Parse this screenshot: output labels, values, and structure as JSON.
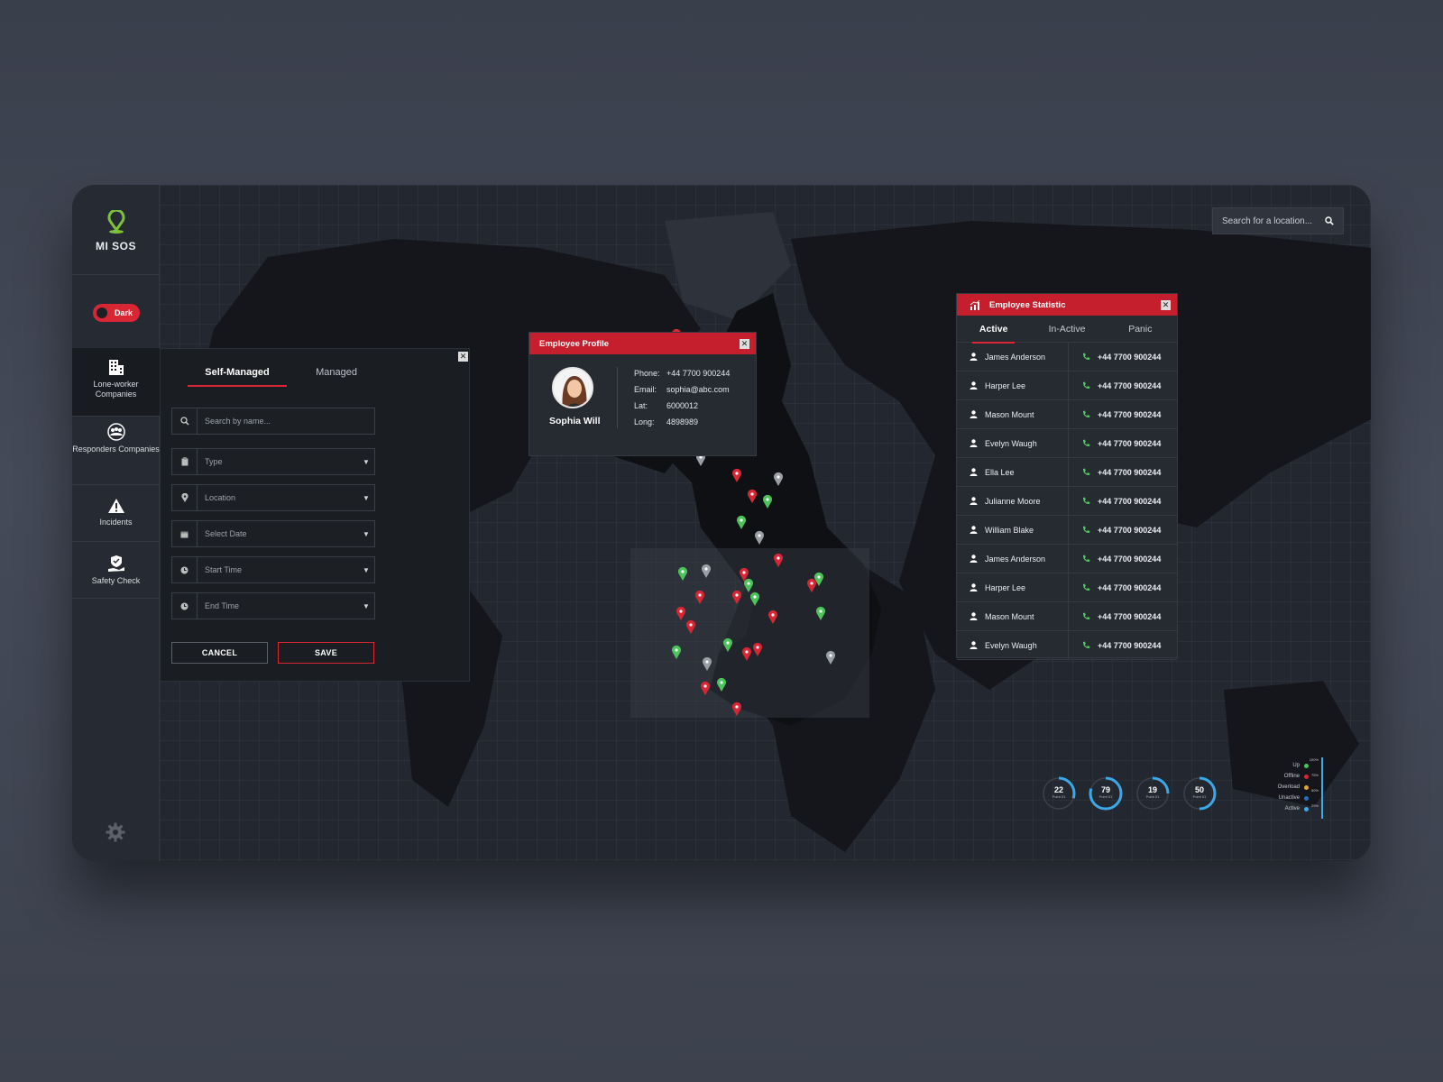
{
  "app": {
    "name": "MI SOS",
    "theme_toggle": "Dark"
  },
  "sidebar": {
    "items": [
      {
        "label": "Lone-worker Companies",
        "icon": "building-icon",
        "active": true
      },
      {
        "label": "Responders Companies",
        "icon": "group-icon",
        "active": false
      },
      {
        "label": "Incidents",
        "icon": "warning-icon",
        "active": false
      },
      {
        "label": "Safety Check",
        "icon": "shield-hand-icon",
        "active": false
      }
    ]
  },
  "search": {
    "placeholder": "Search for a location..."
  },
  "filter": {
    "tabs": [
      "Self-Managed",
      "Managed"
    ],
    "search_placeholder": "Search by name...",
    "fields": [
      {
        "label": "Type",
        "icon": "clipboard-icon"
      },
      {
        "label": "Location",
        "icon": "location-pin-icon"
      },
      {
        "label": "Select Date",
        "icon": "calendar-icon"
      },
      {
        "label": "Start Time",
        "icon": "clock-icon"
      },
      {
        "label": "End Time",
        "icon": "clock-icon"
      }
    ],
    "cancel": "CANCEL",
    "save": "SAVE"
  },
  "profile": {
    "title": "Employee Profile",
    "name": "Sophia Will",
    "phone_label": "Phone:",
    "phone": "+44 7700 900244",
    "email_label": "Email:",
    "email": "sophia@abc.com",
    "lat_label": "Lat:",
    "lat": "6000012",
    "long_label": "Long:",
    "long": "4898989"
  },
  "stats": {
    "title": "Employee Statistic",
    "tabs": [
      "Active",
      "In-Active",
      "Panic"
    ],
    "rows": [
      {
        "name": "James Anderson",
        "phone": "+44 7700 900244"
      },
      {
        "name": "Harper Lee",
        "phone": "+44 7700 900244"
      },
      {
        "name": "Mason Mount",
        "phone": "+44 7700 900244"
      },
      {
        "name": "Evelyn Waugh",
        "phone": "+44 7700 900244"
      },
      {
        "name": "Ella Lee",
        "phone": "+44 7700 900244"
      },
      {
        "name": "Julianne Moore",
        "phone": "+44 7700 900244"
      },
      {
        "name": "William Blake",
        "phone": "+44 7700 900244"
      },
      {
        "name": "James Anderson",
        "phone": "+44 7700 900244"
      },
      {
        "name": "Harper Lee",
        "phone": "+44 7700 900244"
      },
      {
        "name": "Mason Mount",
        "phone": "+44 7700 900244"
      },
      {
        "name": "Evelyn Waugh",
        "phone": "+44 7700 900244"
      }
    ]
  },
  "gauges": [
    {
      "value": "22",
      "sub": "Point 01",
      "fraction": 0.3
    },
    {
      "value": "79",
      "sub": "Point 01",
      "fraction": 0.8
    },
    {
      "value": "19",
      "sub": "Point 01",
      "fraction": 0.25
    },
    {
      "value": "50",
      "sub": "Point 01",
      "fraction": 0.5
    }
  ],
  "legend": {
    "items": [
      {
        "label": "Up",
        "color": "#4cc45b"
      },
      {
        "label": "Offline",
        "color": "#d92635"
      },
      {
        "label": "Overload",
        "color": "#e8a23a"
      },
      {
        "label": "Unactive",
        "color": "#2a6db8"
      },
      {
        "label": "Active",
        "color": "#3da8e8"
      }
    ],
    "scale": [
      "100%",
      "75%",
      "50%",
      "25%"
    ]
  },
  "colors": {
    "accent": "#d92635",
    "up": "#4cc45b",
    "neutral": "#9a9ea5",
    "background": "#1f232a"
  }
}
